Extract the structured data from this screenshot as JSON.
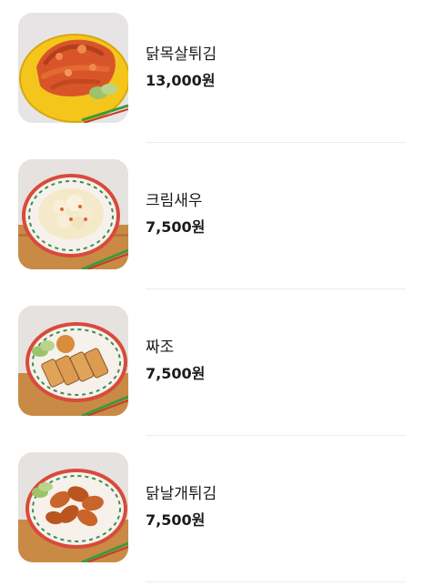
{
  "menu": {
    "items": [
      {
        "name": "닭목살튀김",
        "price": "13,000원",
        "photo": "fried-chicken-neck-photo"
      },
      {
        "name": "크림새우",
        "price": "7,500원",
        "photo": "cream-shrimp-photo"
      },
      {
        "name": "짜조",
        "price": "7,500원",
        "photo": "fried-spring-roll-photo"
      },
      {
        "name": "닭날개튀김",
        "price": "7,500원",
        "photo": "fried-chicken-wing-photo"
      }
    ]
  },
  "colors": {
    "text": "#1a1a1a",
    "divider": "#ececec",
    "thumb_background": "#e9e6e4",
    "plate_yellow": "#f3c21a",
    "wood": "#c98a45"
  }
}
